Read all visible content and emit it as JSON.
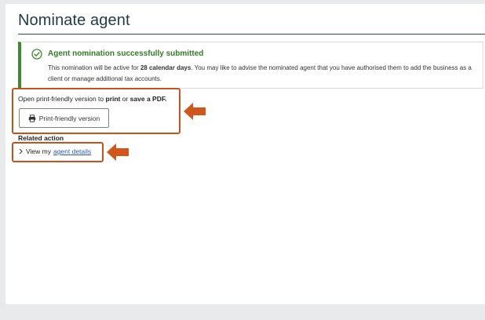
{
  "page": {
    "title": "Nominate agent"
  },
  "success": {
    "heading": "Agent nomination successfully submitted",
    "body_prefix": "This nomination will be active for ",
    "body_bold": "28 calendar days",
    "body_suffix": ". You may like to advise the nominated agent that you have authorised them to add the business as a client or manage additional tax accounts.",
    "icon": "check-circle-icon",
    "accent_color": "#3d8a2f"
  },
  "print": {
    "prompt_prefix": "Open print-friendly version to ",
    "prompt_bold1": "print",
    "prompt_middle": " or ",
    "prompt_bold2": "save a PDF.",
    "button_label": "Print-friendly version",
    "button_icon": "printer-icon"
  },
  "related": {
    "heading": "Related action",
    "link_prefix": "View my ",
    "link_text": "agent details",
    "link_icon": "chevron-right-icon"
  },
  "annotations": {
    "highlight_color": "#c7531b",
    "arrow_color": "#d2561b"
  }
}
